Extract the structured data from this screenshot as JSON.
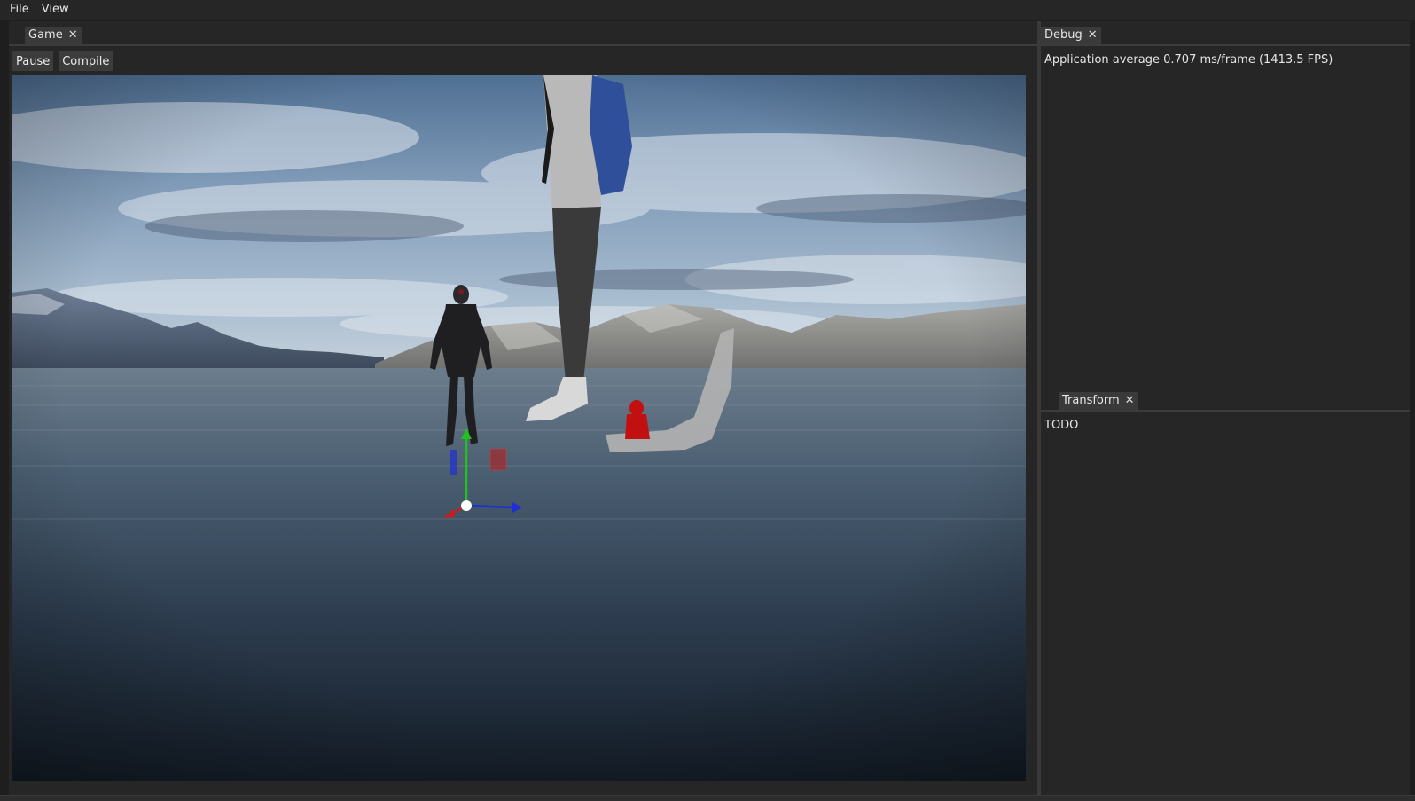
{
  "menu": {
    "file": "File",
    "view": "View"
  },
  "game_panel": {
    "tab_label": "Game",
    "close_glyph": "✕",
    "toolbar": {
      "pause_label": "Pause",
      "compile_label": "Compile"
    }
  },
  "debug_panel": {
    "tab_label": "Debug",
    "close_glyph": "✕",
    "stats_text": "Application average 0.707 ms/frame (1413.5 FPS)"
  },
  "transform_panel": {
    "tab_label": "Transform",
    "close_glyph": "✕",
    "body_text": "TODO"
  },
  "gizmo": {
    "y_axis_color": "#1fc21f",
    "x_axis_color": "#c21f1f",
    "z_axis_color": "#1f2fd6"
  },
  "colors": {
    "background": "#1e1e1e",
    "panel": "#262626",
    "tab": "#3a3a3a",
    "button": "#3c3c3c"
  }
}
